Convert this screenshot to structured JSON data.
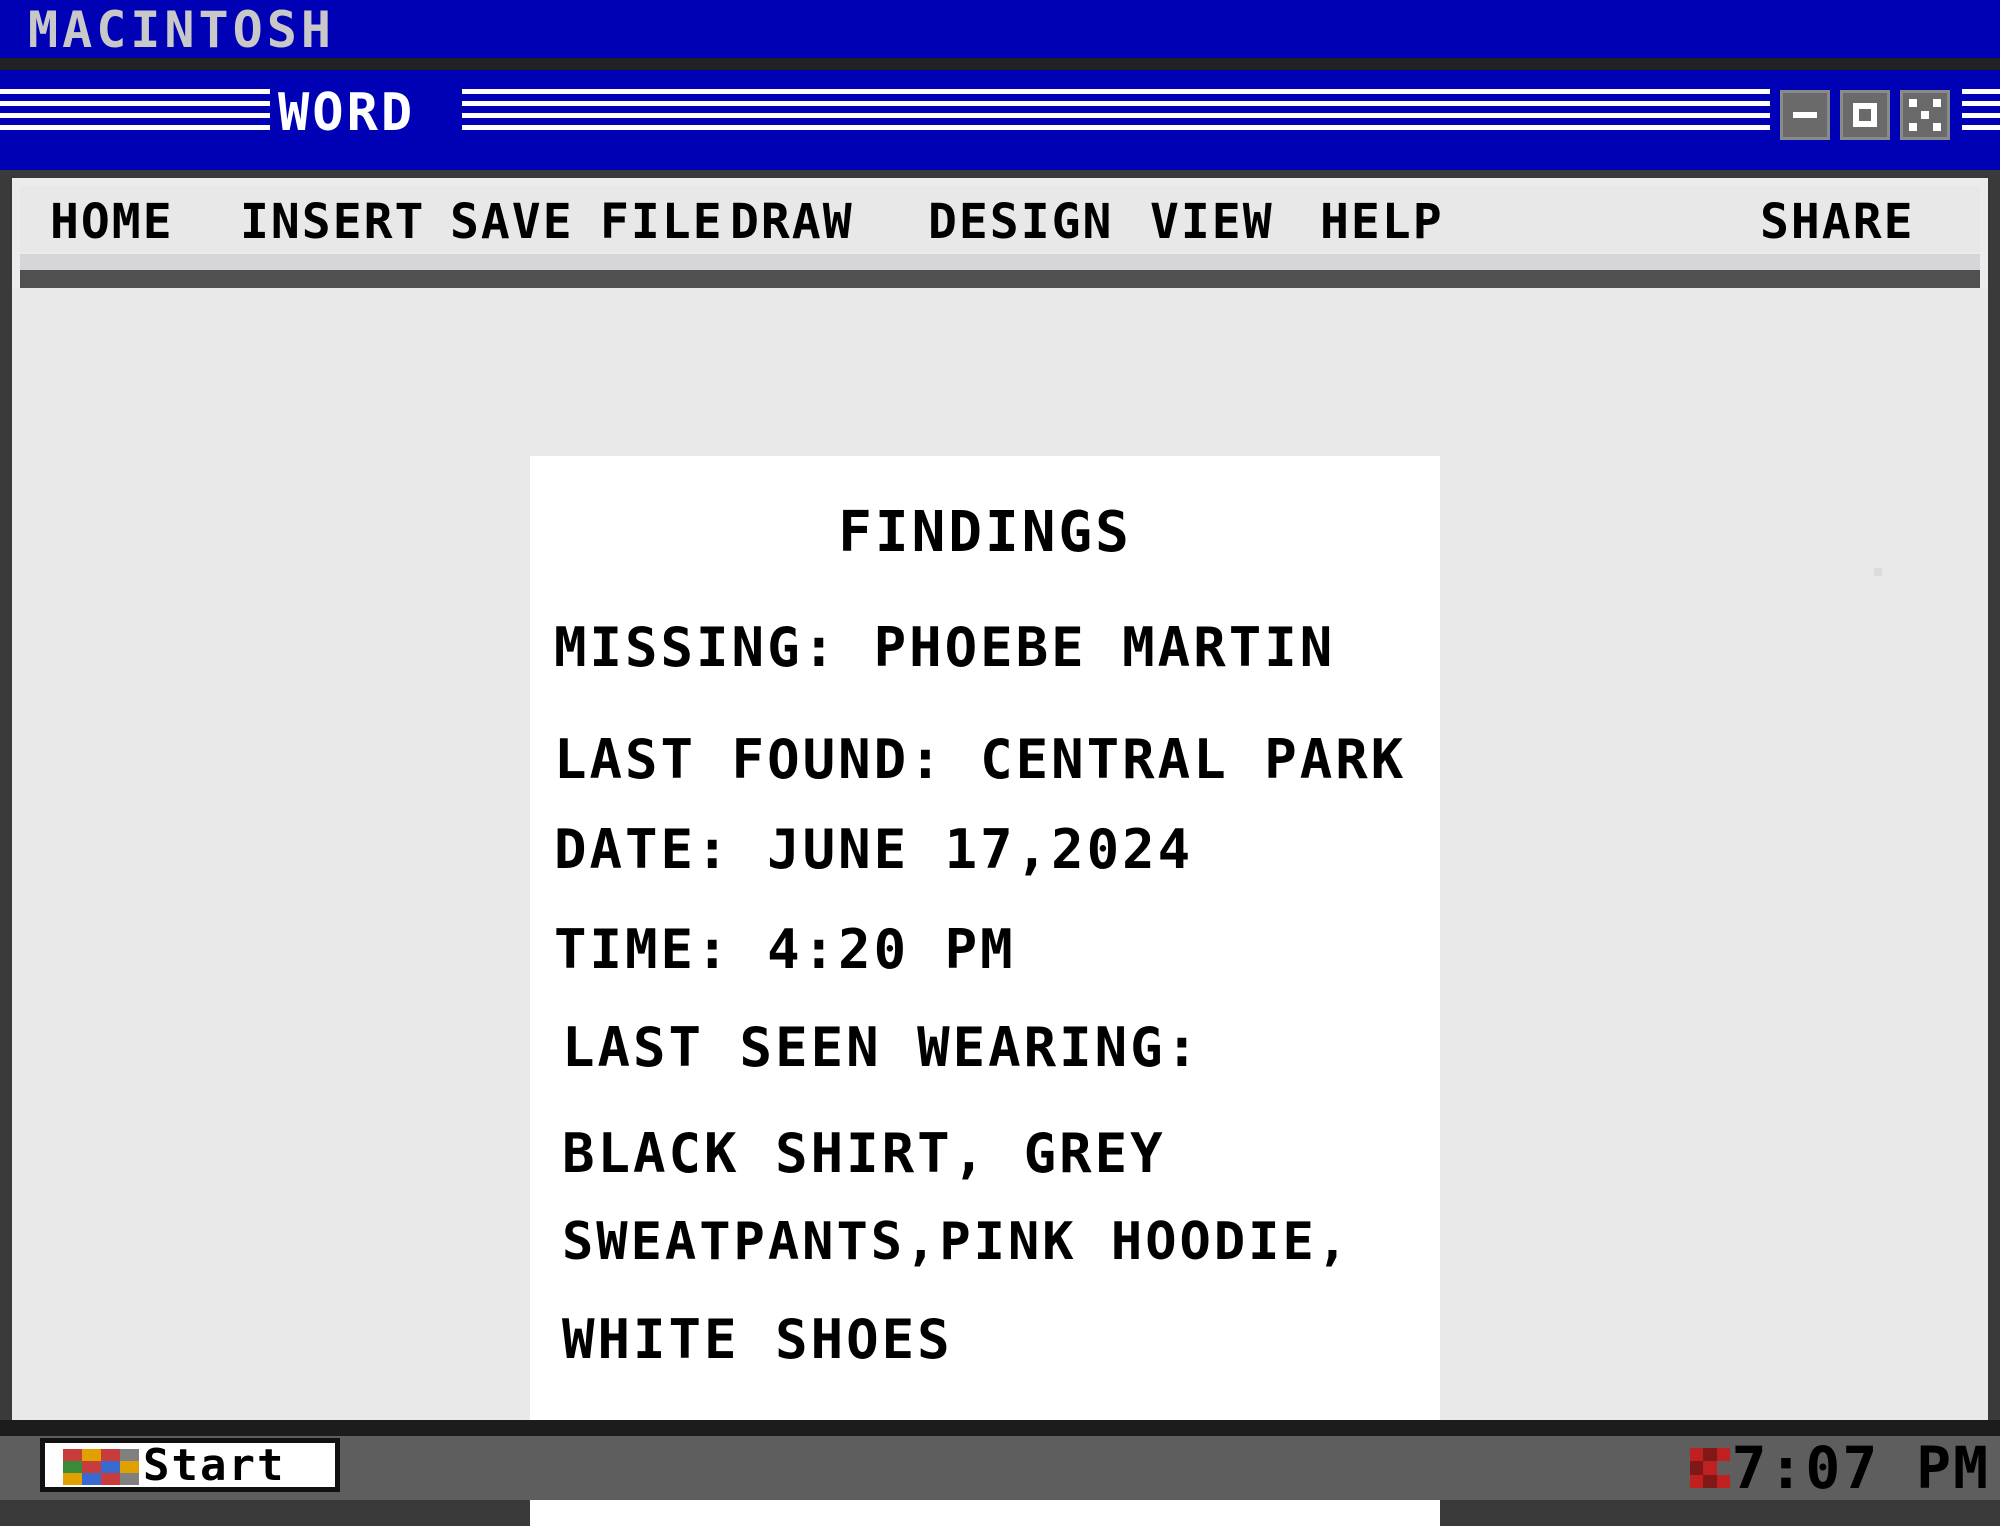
{
  "os": {
    "title": "MACINTOSH"
  },
  "window": {
    "title": "WORD",
    "controls": {
      "minimize": "minimize",
      "maximize": "maximize",
      "close": "close"
    }
  },
  "menu": {
    "items": [
      "HOME",
      "INSERT",
      "SAVE",
      "FILE",
      "DRAW",
      "DESIGN",
      "VIEW",
      "HELP"
    ],
    "share": "SHARE"
  },
  "document": {
    "heading": "FINDINGS",
    "lines": [
      "MISSING: PHOEBE MARTIN",
      "LAST FOUND:  CENTRAL PARK",
      "DATE: JUNE 17,2024",
      "TIME:  4:20 PM",
      "LAST SEEN WEARING:",
      "BLACK  SHIRT, GREY",
      "SWEATPANTS,PINK HOODIE,",
      "WHITE  SHOES"
    ]
  },
  "taskbar": {
    "start_label": "Start",
    "clock": "7:07 PM"
  },
  "colors": {
    "title_blue": "#0000b4",
    "canvas_gray": "#e9e9e9",
    "taskbar_gray": "#5e5e5e"
  },
  "icons": {
    "start_logo": "multicolor-grid-icon",
    "tray": "red-pixel-icon"
  }
}
